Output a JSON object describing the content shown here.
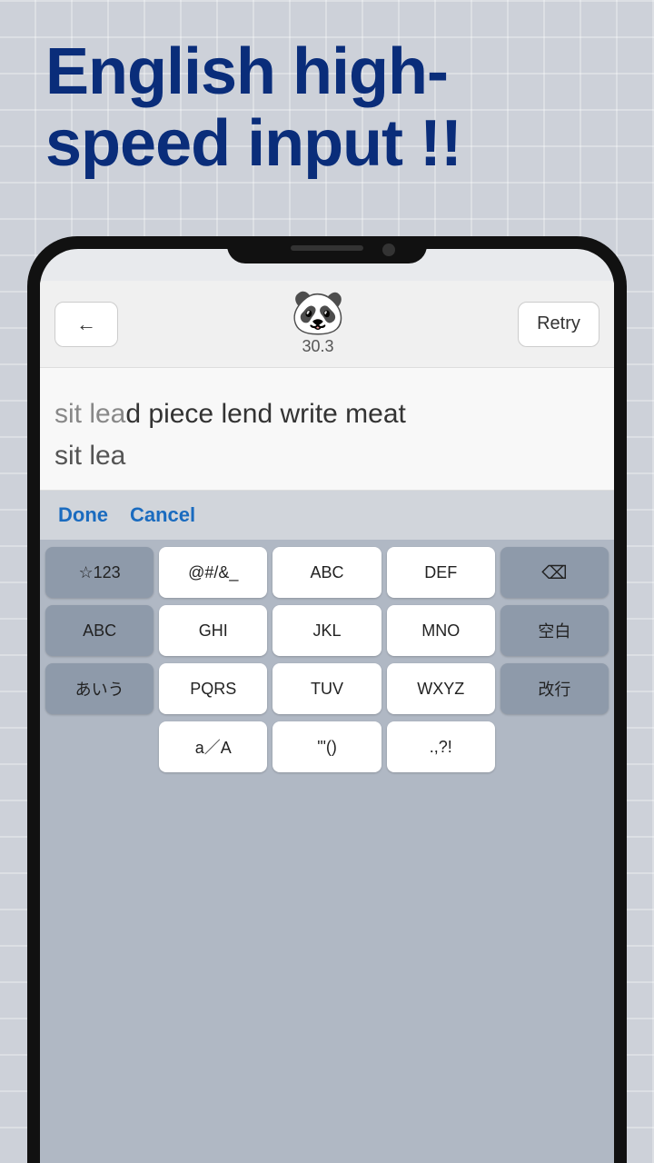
{
  "title": {
    "line1": "English high-",
    "line2": "speed input !!"
  },
  "top_bar": {
    "back_label": "←",
    "score": "30.3",
    "retry_label": "Retry"
  },
  "text_display": {
    "target_typed": "sit lea",
    "target_remaining": "d piece lend write meat",
    "input_current": "sit lea"
  },
  "action_bar": {
    "done_label": "Done",
    "cancel_label": "Cancel"
  },
  "keyboard": {
    "row1": [
      {
        "label": "☆123",
        "type": "dark"
      },
      {
        "label": "@#/&_",
        "type": "light"
      },
      {
        "label": "ABC",
        "type": "light"
      },
      {
        "label": "DEF",
        "type": "light"
      },
      {
        "label": "⌫",
        "type": "dark"
      }
    ],
    "row2": [
      {
        "label": "ABC",
        "type": "dark"
      },
      {
        "label": "GHI",
        "type": "light"
      },
      {
        "label": "JKL",
        "type": "light"
      },
      {
        "label": "MNO",
        "type": "light"
      },
      {
        "label": "空白",
        "type": "dark"
      }
    ],
    "row3_left": {
      "label": "あいう",
      "type": "dark"
    },
    "row3_mid": [
      {
        "label": "PQRS",
        "type": "light"
      },
      {
        "label": "TUV",
        "type": "light"
      },
      {
        "label": "WXYZ",
        "type": "light"
      }
    ],
    "row3_right": {
      "label": "改行",
      "type": "dark"
    },
    "row4_mid": [
      {
        "label": "a／A",
        "type": "light"
      },
      {
        "label": "'\"()",
        "type": "light"
      },
      {
        "label": ".,?!",
        "type": "light"
      }
    ]
  }
}
